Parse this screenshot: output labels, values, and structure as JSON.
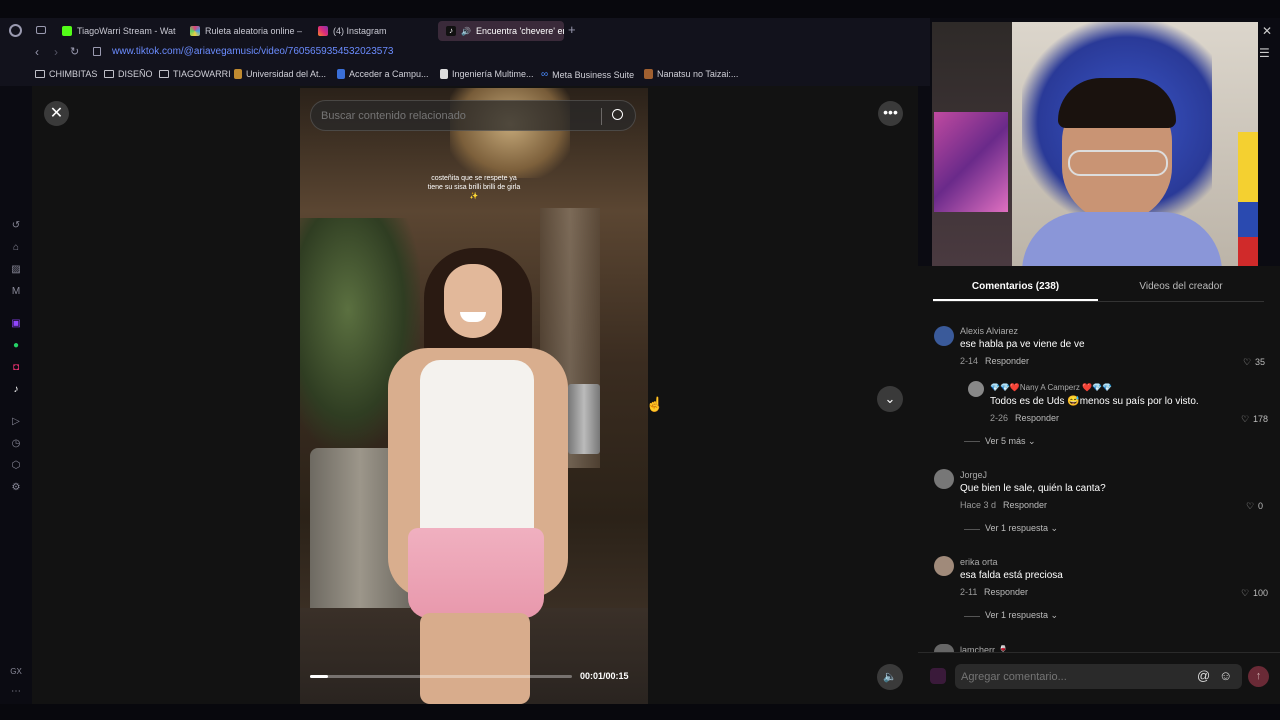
{
  "browser": {
    "tabs": [
      {
        "label": "TiagoWarri Stream - Watc",
        "color": "#53fc18"
      },
      {
        "label": "Ruleta aleatoria online – ru",
        "color": "#e0407a"
      },
      {
        "label": "(4) Instagram",
        "color": "#e1306c"
      },
      {
        "label": "Encuentra 'chevere' en",
        "color": "#111111",
        "active": true
      }
    ],
    "url": "www.tiktok.com/@ariavegamusic/video/7605659354532023573",
    "bookmarks": [
      "CHIMBITAS",
      "DISEÑO",
      "TIAGOWARRI",
      "Universidad del At...",
      "Acceder a Campu...",
      "Ingeniería Multime...",
      "Meta Business Suite",
      "Nanatsu no Taizai:..."
    ]
  },
  "sidebar": {
    "bottom_label": "GX"
  },
  "search": {
    "placeholder": "Buscar contenido relacionado"
  },
  "video": {
    "caption": "costeñita que se respete ya tiene su sisa brilli brilli de girla ✨",
    "time": "00:01/00:15",
    "progress": 0.07
  },
  "tabs": {
    "comments": "Comentarios (238)",
    "creator_videos": "Videos del creador"
  },
  "comments": [
    {
      "user": "Alexis Alviarez",
      "text": "ese habla pa ve viene de ve",
      "date": "2-14",
      "reply": "Responder",
      "likes": "35"
    },
    {
      "user": "💎💎❤️Nany A Camperz ❤️💎💎",
      "text": "Todos es de Uds 😅menos su país por lo visto.",
      "date": "2-26",
      "reply": "Responder",
      "likes": "178",
      "nested": true
    },
    {
      "more": "Ver 5 más"
    },
    {
      "user": "JorgeJ",
      "text": "Que bien le sale, quién la canta?",
      "date": "Hace 3 d",
      "reply": "Responder",
      "likes": "0"
    },
    {
      "more": "Ver 1 respuesta"
    },
    {
      "user": "erika orta",
      "text": "esa falda está preciosa",
      "date": "2-11",
      "reply": "Responder",
      "likes": "100"
    },
    {
      "more": "Ver 1 respuesta"
    },
    {
      "user": "lamcherr 🍷",
      "text": "",
      "date": "",
      "reply": "",
      "likes": ""
    }
  ],
  "comment_input": {
    "placeholder": "Agregar comentario..."
  }
}
